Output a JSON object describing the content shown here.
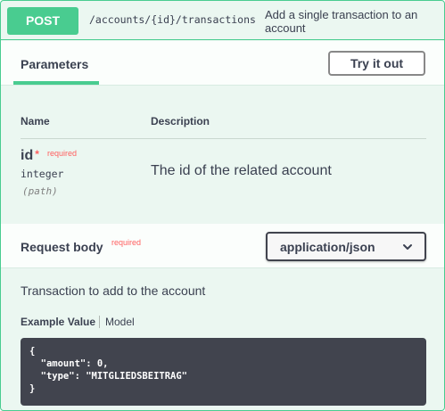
{
  "summary": {
    "method": "POST",
    "path": "/accounts/{id}/transactions",
    "description": "Add a single transaction to an account"
  },
  "parameters": {
    "tab_label": "Parameters",
    "try_button": "Try it out",
    "col_name": "Name",
    "col_description": "Description",
    "items": [
      {
        "name": "id",
        "required_star": "*",
        "required_label": "required",
        "type": "integer",
        "location": "(path)",
        "description": "The id of the related account"
      }
    ]
  },
  "request_body": {
    "title": "Request body",
    "required_label": "required",
    "content_type": "application/json",
    "description": "Transaction to add to the account",
    "example_tab": "Example Value",
    "model_tab": "Model",
    "example_code": "{\n  \"amount\": 0,\n  \"type\": \"MITGLIEDSBEITRAG\"\n}"
  },
  "colors": {
    "post_accent": "#49cc90",
    "background": "#ebf7f1",
    "required": "#ff6060",
    "code_background": "#41444e"
  },
  "icons": {
    "select_chevron": "chevron-down-icon"
  }
}
